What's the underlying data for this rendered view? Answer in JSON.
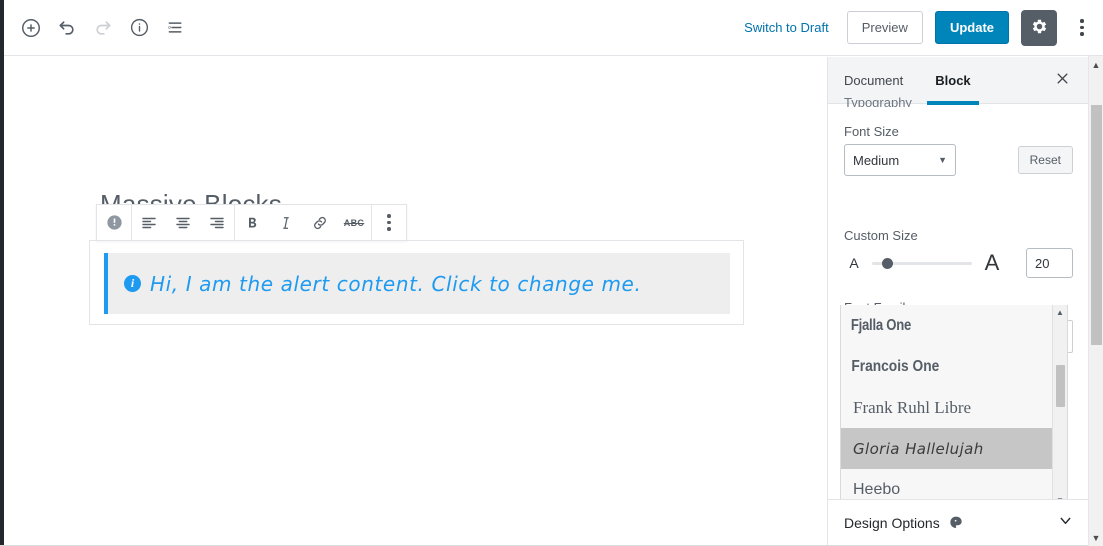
{
  "topbar": {
    "left_tools": [
      {
        "name": "add-block-button",
        "icon": "plus-circle-icon",
        "label": "Add block",
        "disabled": false
      },
      {
        "name": "undo-button",
        "icon": "undo-icon",
        "label": "Undo",
        "disabled": false
      },
      {
        "name": "redo-button",
        "icon": "redo-icon",
        "label": "Redo",
        "disabled": true
      },
      {
        "name": "content-info-button",
        "icon": "info-circle-icon",
        "label": "Content structure",
        "disabled": false
      },
      {
        "name": "block-navigation-button",
        "icon": "list-view-icon",
        "label": "Block navigation",
        "disabled": false
      }
    ],
    "switch_to_draft": "Switch to Draft",
    "preview": "Preview",
    "update": "Update",
    "settings_label": "Settings",
    "more_label": "More tools & options"
  },
  "editor": {
    "post_title": "Massive Blocks",
    "block_toolbar": [
      {
        "name": "block-type-alert-icon",
        "icon": "alert-circle-icon",
        "label": "Alert block"
      },
      {
        "name": "align-left-button",
        "icon": "align-left-icon",
        "label": "Align left"
      },
      {
        "name": "align-center-button",
        "icon": "align-center-icon",
        "label": "Align center"
      },
      {
        "name": "align-right-button",
        "icon": "align-right-icon",
        "label": "Align right"
      },
      {
        "name": "bold-button",
        "icon": "bold-icon",
        "label": "B"
      },
      {
        "name": "italic-button",
        "icon": "italic-icon",
        "label": "I"
      },
      {
        "name": "link-button",
        "icon": "link-icon",
        "label": "Link"
      },
      {
        "name": "strikethrough-button",
        "icon": "strikethrough-icon",
        "label": "ABC"
      },
      {
        "name": "block-more-options-button",
        "icon": "kebab-menu-icon",
        "label": "More options"
      }
    ],
    "alert": {
      "icon": "info-circle-icon",
      "text": "Hi, I am the alert content. Click to change me.",
      "accent_color": "#1e9bf0",
      "background_color": "#eeeeee"
    }
  },
  "sidebar": {
    "tabs": [
      {
        "name": "tab-document",
        "label": "Document",
        "active": false
      },
      {
        "name": "tab-block",
        "label": "Block",
        "active": true
      }
    ],
    "close_label": "Close settings",
    "clipped_heading": "Typography",
    "font_size": {
      "label": "Font Size",
      "value": "Medium",
      "reset_label": "Reset"
    },
    "custom_size": {
      "label": "Custom Size",
      "small_glyph": "A",
      "large_glyph": "A",
      "value": "20"
    },
    "font_family": {
      "label": "Font Family",
      "value": "Gloria Hallelujah",
      "open": true,
      "options": [
        {
          "label": "Fjalla One",
          "style": "f-fjalla",
          "selected": false
        },
        {
          "label": "Francois One",
          "style": "f-francois",
          "selected": false
        },
        {
          "label": "Frank Ruhl Libre",
          "style": "f-frank",
          "selected": false
        },
        {
          "label": "Gloria Hallelujah",
          "style": "f-gloria",
          "selected": true
        },
        {
          "label": "Heebo",
          "style": "f-heebo",
          "selected": false
        }
      ]
    },
    "design_options": {
      "label": "Design Options",
      "icon": "paint-blob-icon"
    }
  },
  "colors": {
    "accent_blue": "#0085ba",
    "link_blue": "#0073aa",
    "alert_blue": "#1e9bf0",
    "gear_bg": "#555d66"
  }
}
